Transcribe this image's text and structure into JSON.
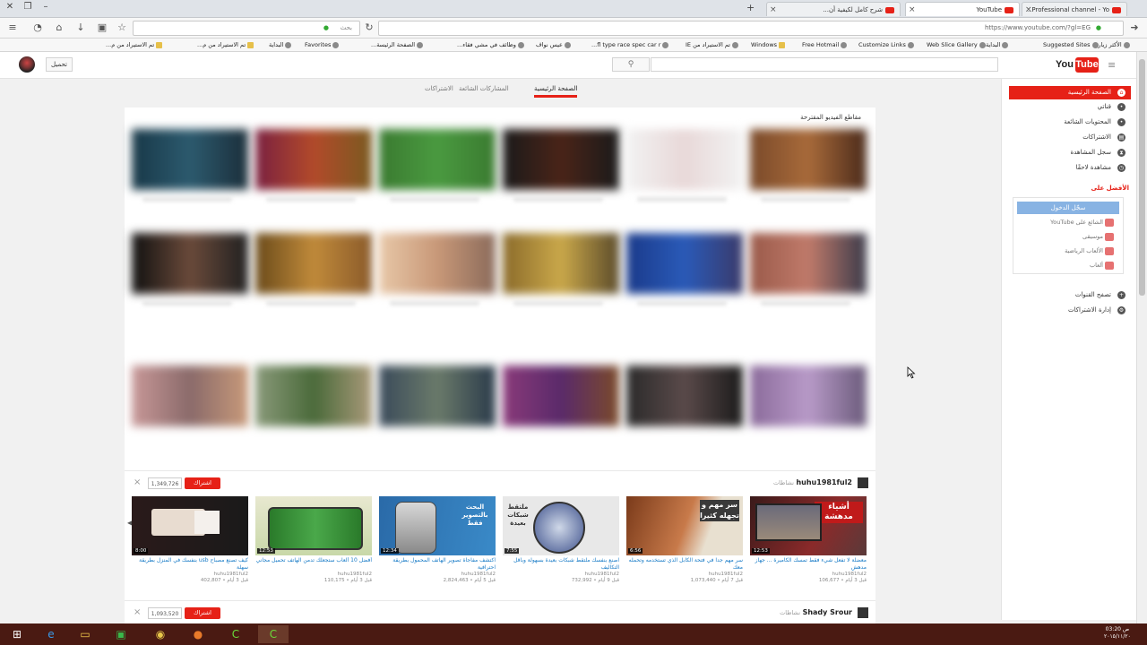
{
  "browser": {
    "tabs": [
      {
        "title": "Professional channel - Yo...",
        "active": false
      },
      {
        "title": "YouTube",
        "active": true
      },
      {
        "title": "شرح كامل لكيفية أن...",
        "active": false
      }
    ],
    "new_tab": "+",
    "url": "https://www.youtube.com/?gl=EG",
    "search_placeholder": "بحث",
    "bookmarks": [
      "Suggested Sites",
      "Web Slice Gallery",
      "Customize Links",
      "Free Hotmail",
      "Windows",
      "تم الاستيراد من IE",
      "fl type race spec car r...",
      "عيس نواف",
      "وظائف في مشي فقاء...",
      "الصفحة الرئيسة...",
      "Favorites",
      "البداية",
      "تم الاستيراد من م...",
      "تم الاستيراد من م...",
      "الأكثر زيارة",
      "البداية"
    ]
  },
  "youtube": {
    "logo_you": "You",
    "logo_tube": "Tube",
    "search_placeholder": "",
    "upload_label": "تحميل",
    "tabs": [
      {
        "label": "الصفحة الرئيسية",
        "active": true
      },
      {
        "label": "المشاركات الشائعة",
        "active": false
      },
      {
        "label": "الاشتراكات",
        "active": false
      }
    ],
    "sidebar": {
      "items": [
        {
          "label": "الصفحة الرئيسية",
          "icon": "home-icon",
          "active": true
        },
        {
          "label": "قناتي",
          "icon": "user-icon",
          "active": false
        },
        {
          "label": "المحتويات الشائعة",
          "icon": "fire-icon",
          "active": false
        },
        {
          "label": "الاشتراكات",
          "icon": "subscriptions-icon",
          "active": false
        },
        {
          "label": "سجل المشاهدة",
          "icon": "history-icon",
          "active": false
        },
        {
          "label": "مشاهدة لاحقًا",
          "icon": "clock-icon",
          "active": false
        }
      ],
      "section_header": "الأفضل على",
      "box_button": "سجّل الدخول",
      "box_items": [
        "الشائع على YouTube",
        "موسيقى",
        "الألعاب الرياضية",
        "ألعاب"
      ],
      "bottom_items": [
        "تصفح القنوات",
        "إدارة الاشتراكات"
      ]
    },
    "section_title": "مقاطع الفيديو المقترحة",
    "shelves": [
      {
        "channel": "huhu1981ful2",
        "tag": "نشاطات",
        "subscribe": "اشتراك",
        "subscribers": "1,349,726",
        "videos": [
          {
            "title": "معضلة لا تفعل شيء فقط تمسك الكاميرة ... جهاز مدهش",
            "by": "huhu1981ful2",
            "meta": "قبل 3 أيام • 106,677",
            "duration": "12:53",
            "thumb_text": "أشياء مدهشة"
          },
          {
            "title": "سر مهم جداً في فتحة الكابل الذي تستخدمه وتحمله معك",
            "by": "huhu1981ful2",
            "meta": "قبل 7 أيام • 1,073,440",
            "duration": "6:56",
            "thumb_text": "سر مهم و تجهله كثيرا"
          },
          {
            "title": "اصنع بنفسك ملتقط شبكات بعيدة بسهولة وبأقل التكاليف",
            "by": "huhu1981ful2",
            "meta": "قبل 9 أيام • 732,992",
            "duration": "7:55",
            "thumb_text": "ملتقط شبكات بعيدة"
          },
          {
            "title": "اكتشف مفاجأة تصوير الهاتف المحمول بطريقة احترافية",
            "by": "huhu1981ful2",
            "meta": "قبل 5 أيام • 2,824,463",
            "duration": "12:34",
            "thumb_text": "البحث بالتصوير فقط"
          },
          {
            "title": "أفضل 10 ألعاب ستجعلك تدمن الهاتف تحميل مجاني",
            "by": "huhu1981ful2",
            "meta": "قبل 3 أيام • 110,175",
            "duration": "12:53",
            "thumb_text": ""
          },
          {
            "title": "كيف تصنع مصباح usb بنفسك في المنزل بطريقة سهلة",
            "by": "huhu1981ful2",
            "meta": "قبل 3 أيام • 402,807",
            "duration": "8:00",
            "thumb_text": ""
          }
        ]
      },
      {
        "channel": "Shady Srour",
        "tag": "نشاطات",
        "subscribe": "اشتراك",
        "subscribers": "1,093,520"
      }
    ]
  },
  "taskbar": {
    "clock_time": "03:20 ص",
    "clock_date": "٢٠١٥/١١/٢٠"
  },
  "colors": {
    "accent": "#e62117",
    "link": "#167ac6"
  }
}
